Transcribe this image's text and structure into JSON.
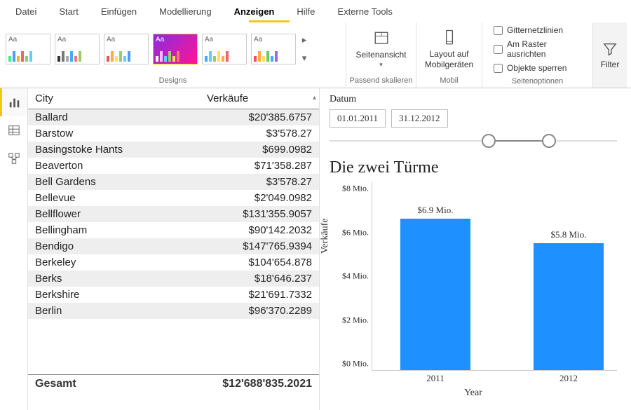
{
  "menu": {
    "items": [
      "Datei",
      "Start",
      "Einfügen",
      "Modellierung",
      "Anzeigen",
      "Hilfe",
      "Externe Tools"
    ],
    "active": 4
  },
  "ribbon": {
    "themes_label": "Designs",
    "page_view": {
      "label": "Seitenansicht",
      "group": "Passend skalieren"
    },
    "mobile": {
      "label": "Layout auf Mobilgeräten",
      "group": "Mobil"
    },
    "options": {
      "grid": "Gitternetzlinien",
      "snap": "Am Raster ausrichten",
      "lock": "Objekte sperren",
      "group": "Seitenoptionen"
    },
    "filter": "Filter"
  },
  "table": {
    "col1": "City",
    "col2": "Verkäufe",
    "rows": [
      {
        "city": "Ballard",
        "val": "$20'385.6757"
      },
      {
        "city": "Barstow",
        "val": "$3'578.27"
      },
      {
        "city": "Basingstoke Hants",
        "val": "$699.0982"
      },
      {
        "city": "Beaverton",
        "val": "$71'358.287"
      },
      {
        "city": "Bell Gardens",
        "val": "$3'578.27"
      },
      {
        "city": "Bellevue",
        "val": "$2'049.0982"
      },
      {
        "city": "Bellflower",
        "val": "$131'355.9057"
      },
      {
        "city": "Bellingham",
        "val": "$90'142.2032"
      },
      {
        "city": "Bendigo",
        "val": "$147'765.9394"
      },
      {
        "city": "Berkeley",
        "val": "$104'654.878"
      },
      {
        "city": "Berks",
        "val": "$18'646.237"
      },
      {
        "city": "Berkshire",
        "val": "$21'691.7332"
      },
      {
        "city": "Berlin",
        "val": "$96'370.2289"
      }
    ],
    "total_label": "Gesamt",
    "total_val": "$12'688'835.2021"
  },
  "slicer": {
    "label": "Datum",
    "from": "01.01.2011",
    "to": "31.12.2012"
  },
  "chart_data": {
    "type": "bar",
    "title": "Die zwei Türme",
    "xlabel": "Year",
    "ylabel": "Verkäufe",
    "categories": [
      "2011",
      "2012"
    ],
    "values": [
      6.9,
      5.8
    ],
    "value_labels": [
      "$6.9 Mio.",
      "$5.8 Mio."
    ],
    "ylim": [
      0,
      8
    ],
    "yticks": [
      "$0 Mio.",
      "$2 Mio.",
      "$4 Mio.",
      "$6 Mio.",
      "$8 Mio."
    ]
  }
}
